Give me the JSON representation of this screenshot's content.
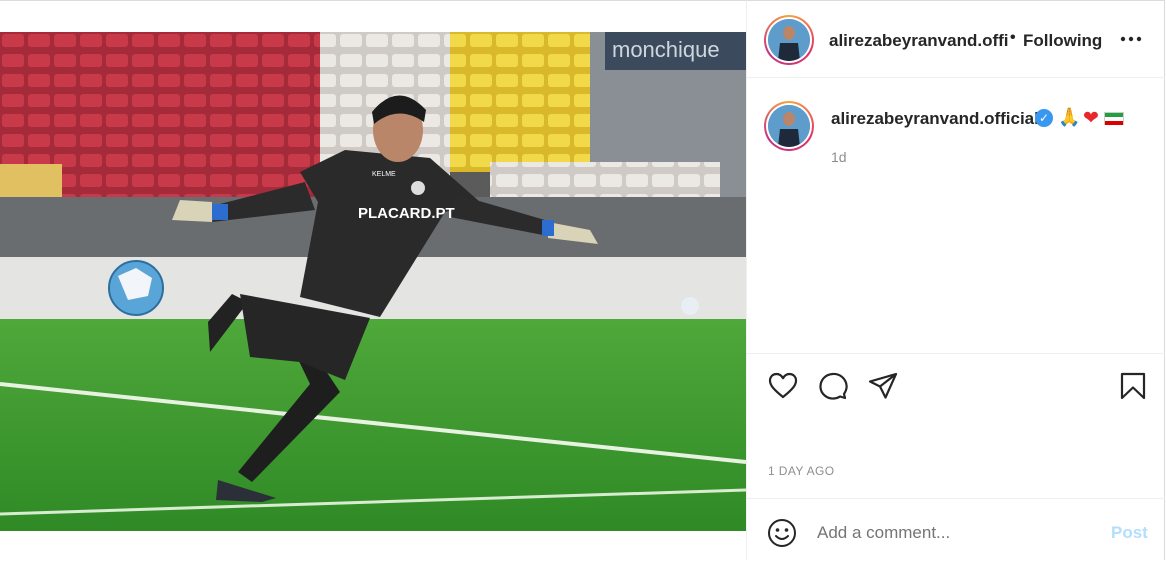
{
  "post": {
    "header": {
      "username": "alirezabeyranvand.offi",
      "separator": "•",
      "follow_state": "Following",
      "more_icon": "more-horizontal-icon"
    },
    "caption": {
      "username": "alirezabeyranvand.official",
      "verified": "✓",
      "emojis": [
        "🙏",
        "❤"
      ],
      "time_ago": "1d"
    },
    "date_label": "1 DAY AGO",
    "comment": {
      "placeholder": "Add a comment...",
      "post_label": "Post"
    },
    "photo": {
      "jersey_brand": "KELME",
      "jersey_sponsor": "PLACARD.PT",
      "stadium_sign": "monchique"
    }
  },
  "colors": {
    "accent": "#0095f6",
    "post_disabled": "#b2dffc",
    "muted_text": "#8e8e8e",
    "border": "#dbdbdb",
    "verified": "#3897f0"
  },
  "icons": [
    "heart-icon",
    "comment-icon",
    "share-icon",
    "save-icon",
    "emoji-icon"
  ]
}
